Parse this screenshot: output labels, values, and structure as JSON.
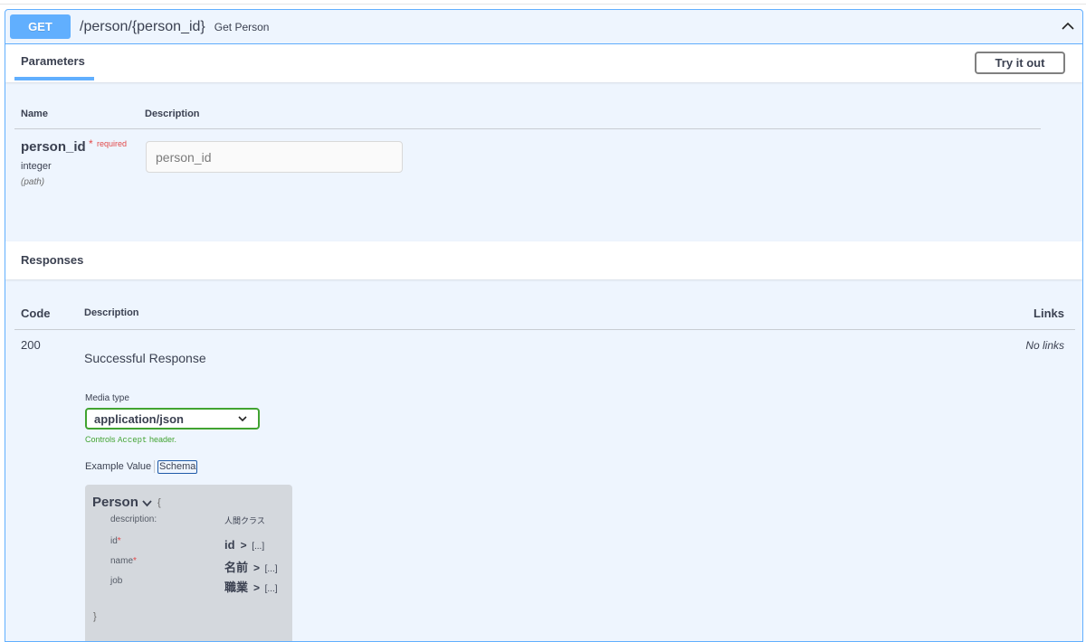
{
  "operation": {
    "method": "GET",
    "path": "/person/{person_id}",
    "summary": "Get Person"
  },
  "parameters": {
    "tab_label": "Parameters",
    "try_button": "Try it out",
    "col_name": "Name",
    "col_description": "Description",
    "param": {
      "name": "person_id",
      "required_star": "*",
      "required_text": "required",
      "type": "integer",
      "in": "(path)",
      "placeholder": "person_id"
    }
  },
  "responses": {
    "title": "Responses",
    "col_code": "Code",
    "col_description": "Description",
    "col_links": "Links",
    "row": {
      "code": "200",
      "description": "Successful Response",
      "links": "No links",
      "media_label": "Media type",
      "media_value": "application/json",
      "controls_prefix": "Controls",
      "controls_code": "Accept",
      "controls_suffix": "header.",
      "example_tab": "Example Value",
      "schema_tab": "Schema"
    }
  },
  "model": {
    "title": "Person",
    "brace_open": "{",
    "brace_close": "}",
    "description_label": "description:",
    "description_value": "人間クラス",
    "properties": [
      {
        "name": "id",
        "required": "*",
        "type_title": "id",
        "arrow": ">",
        "ellipsis": "[...]"
      },
      {
        "name": "name",
        "required": "*",
        "type_title": "名前",
        "arrow": ">",
        "ellipsis": "[...]"
      },
      {
        "name": "job",
        "required": "",
        "type_title": "職業",
        "arrow": ">",
        "ellipsis": "[...]"
      }
    ]
  },
  "colors": {
    "get_accent": "#61affe",
    "required_red": "#e24a4a",
    "media_green": "#41a331"
  }
}
